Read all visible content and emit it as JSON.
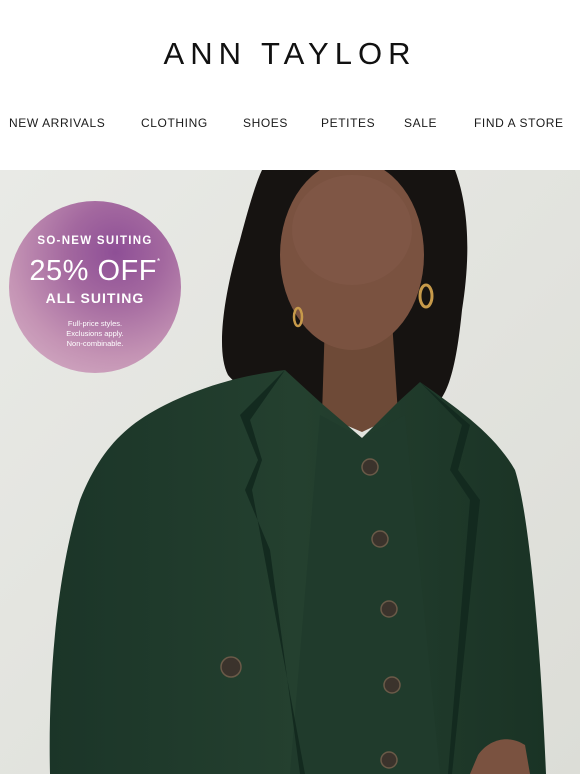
{
  "brand": {
    "logo_text": "ANN TAYLOR"
  },
  "nav": {
    "items": [
      {
        "label": "NEW ARRIVALS"
      },
      {
        "label": "CLOTHING"
      },
      {
        "label": "SHOES"
      },
      {
        "label": "PETITES"
      },
      {
        "label": "SALE"
      },
      {
        "label": "FIND A STORE"
      }
    ]
  },
  "promo": {
    "eyebrow": "SO-NEW SUITING",
    "headline": "25% OFF",
    "headline_mark": "*",
    "subhead": "ALL SUITING",
    "fine_print": [
      "Full-price styles.",
      "Exclusions apply.",
      "Non-combinable."
    ]
  },
  "hero": {
    "image": "woman-in-dark-green-suit-photo"
  },
  "colors": {
    "badge_purple": "#8e4f96",
    "badge_pink": "#d9b6c9",
    "suit_green": "#1e3a2c",
    "background": "#e7e8e3"
  }
}
